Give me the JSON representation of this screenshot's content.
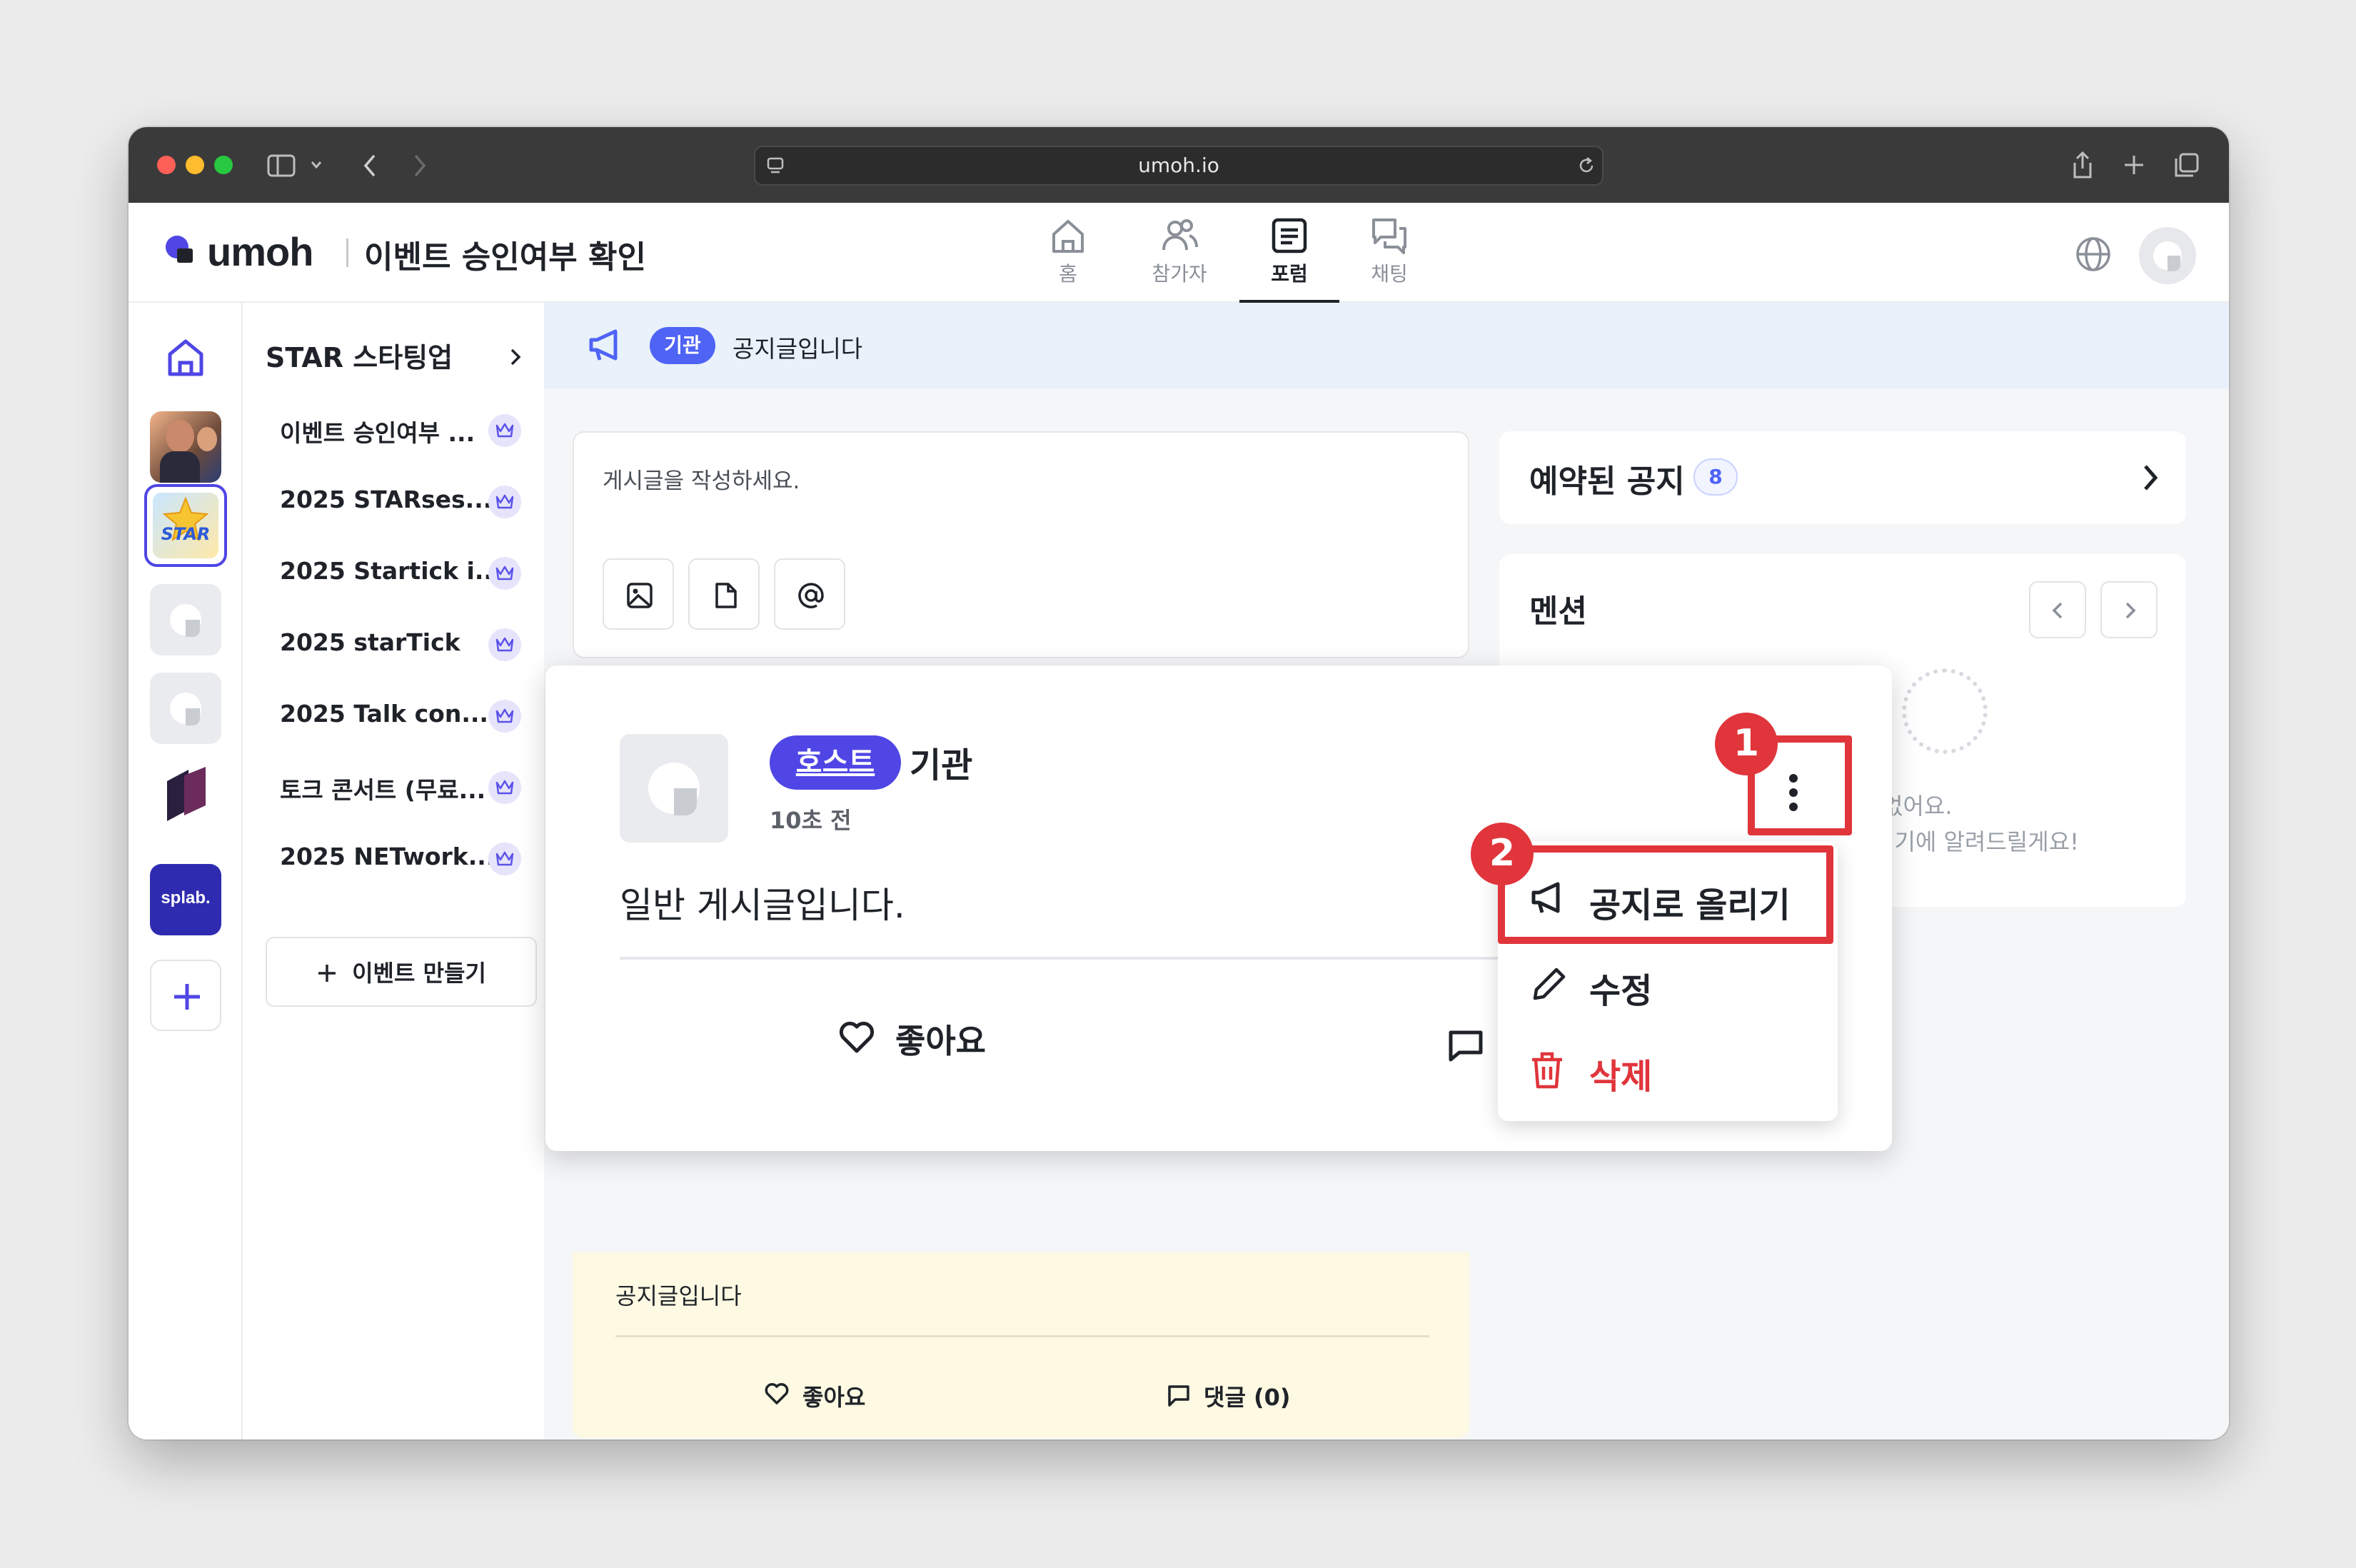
{
  "browser": {
    "url": "umoh.io"
  },
  "header": {
    "brand": "umoh",
    "title": "이벤트 승인여부 확인",
    "tabs": [
      {
        "label": "홈",
        "icon": "home-icon"
      },
      {
        "label": "참가자",
        "icon": "users-icon"
      },
      {
        "label": "포럼",
        "icon": "forum-icon",
        "active": true
      },
      {
        "label": "채팅",
        "icon": "chat-icon"
      }
    ]
  },
  "rail": {
    "splab_label": "splab.",
    "star_label": "STAR"
  },
  "sidebar": {
    "group_title": "STAR 스타팅업",
    "items": [
      {
        "label": "이벤트 승인여부 ..."
      },
      {
        "label": "2025 STARses..."
      },
      {
        "label": "2025 Startick i..."
      },
      {
        "label": "2025 starTick"
      },
      {
        "label": "2025 Talk con..."
      },
      {
        "label": "토크 콘서트 (무료..."
      },
      {
        "label": "2025 NETwork..."
      }
    ],
    "create_button": "이벤트 만들기"
  },
  "notice_bar": {
    "badge": "기관",
    "text": "공지글입니다"
  },
  "composer": {
    "placeholder": "게시글을 작성하세요."
  },
  "reserved": {
    "title": "예약된 공지",
    "count": "8"
  },
  "mentions": {
    "title": "멘션",
    "empty_line1": "없어요.",
    "empty_line2": "여기에 알려드릴게요!"
  },
  "background_post": {
    "text": "공지글입니다",
    "like": "좋아요",
    "comment": "댓글 (0)"
  },
  "post": {
    "host_badge": "호스트",
    "author": "기관",
    "time": "10초 전",
    "body": "일반 게시글입니다.",
    "like": "좋아요"
  },
  "menu": {
    "items": [
      {
        "label": "공지로 올리기",
        "icon": "megaphone-icon"
      },
      {
        "label": "수정",
        "icon": "pencil-icon"
      },
      {
        "label": "삭제",
        "icon": "trash-icon",
        "color": "#e0353b"
      }
    ]
  },
  "annotations": {
    "step1": "1",
    "step2": "2",
    "color": "#e0353b"
  },
  "colors": {
    "accent": "#4f46e5",
    "notice_bg": "#e9f1fb",
    "yellow_post": "#fdf9e2"
  }
}
